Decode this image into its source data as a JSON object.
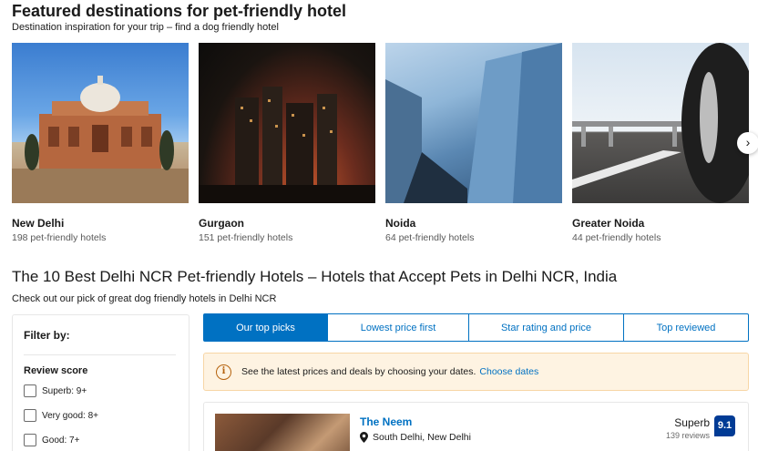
{
  "featured": {
    "title": "Featured destinations for pet-friendly hotel",
    "subtitle": "Destination inspiration for your trip – find a dog friendly hotel",
    "cards": [
      {
        "name": "New Delhi",
        "count": "198 pet-friendly hotels"
      },
      {
        "name": "Gurgaon",
        "count": "151 pet-friendly hotels"
      },
      {
        "name": "Noida",
        "count": "64 pet-friendly hotels"
      },
      {
        "name": "Greater Noida",
        "count": "44 pet-friendly hotels"
      }
    ],
    "next_arrow": "›"
  },
  "best": {
    "title": "The 10 Best Delhi NCR Pet-friendly Hotels – Hotels that Accept Pets in Delhi NCR, India",
    "subtitle": "Check out our pick of great dog friendly hotels in Delhi NCR"
  },
  "filter": {
    "title": "Filter by:",
    "group_title": "Review score",
    "options": [
      "Superb: 9+",
      "Very good: 8+",
      "Good: 7+"
    ]
  },
  "tabs": [
    "Our top picks",
    "Lowest price first",
    "Star rating and price",
    "Top reviewed"
  ],
  "notice": {
    "icon": "i",
    "text": "See the latest prices and deals by choosing your dates.",
    "link": "Choose dates"
  },
  "hotel": {
    "name": "The Neem",
    "location": "South Delhi, New Delhi",
    "rating_word": "Superb",
    "reviews": "139 reviews",
    "score": "9.1"
  },
  "colors": {
    "accent": "#0071c2",
    "score_badge": "#003b95",
    "notice_bg": "#fef3e2"
  }
}
